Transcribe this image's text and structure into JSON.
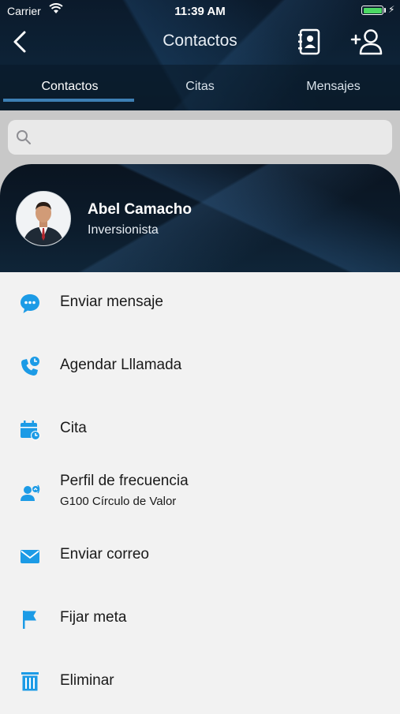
{
  "status_bar": {
    "carrier": "Carrier",
    "time": "11:39 AM",
    "battery_level": 1.0
  },
  "nav": {
    "title": "Contactos"
  },
  "tabs": [
    {
      "label": "Contactos",
      "active": true
    },
    {
      "label": "Citas",
      "active": false
    },
    {
      "label": "Mensajes",
      "active": false
    }
  ],
  "search": {
    "placeholder": "",
    "value": ""
  },
  "profile": {
    "name": "Abel Camacho",
    "role": "Inversionista"
  },
  "actions": [
    {
      "label": "Enviar mensaje",
      "icon": "message-bubble-icon"
    },
    {
      "label": "Agendar Lllamada",
      "icon": "phone-clock-icon"
    },
    {
      "label": "Cita",
      "icon": "calendar-clock-icon"
    },
    {
      "label": "Perfil de frecuencia",
      "sublabel": "G100 Círculo de Valor",
      "icon": "users-frequency-icon"
    },
    {
      "label": "Enviar correo",
      "icon": "envelope-icon"
    },
    {
      "label": "Fijar meta",
      "icon": "flag-icon"
    },
    {
      "label": "Eliminar",
      "icon": "trash-icon"
    }
  ],
  "colors": {
    "accent": "#1c9be6",
    "header_dark": "#0c1d2e",
    "tab_indicator": "#3d7fb4",
    "battery": "#4cd964"
  }
}
